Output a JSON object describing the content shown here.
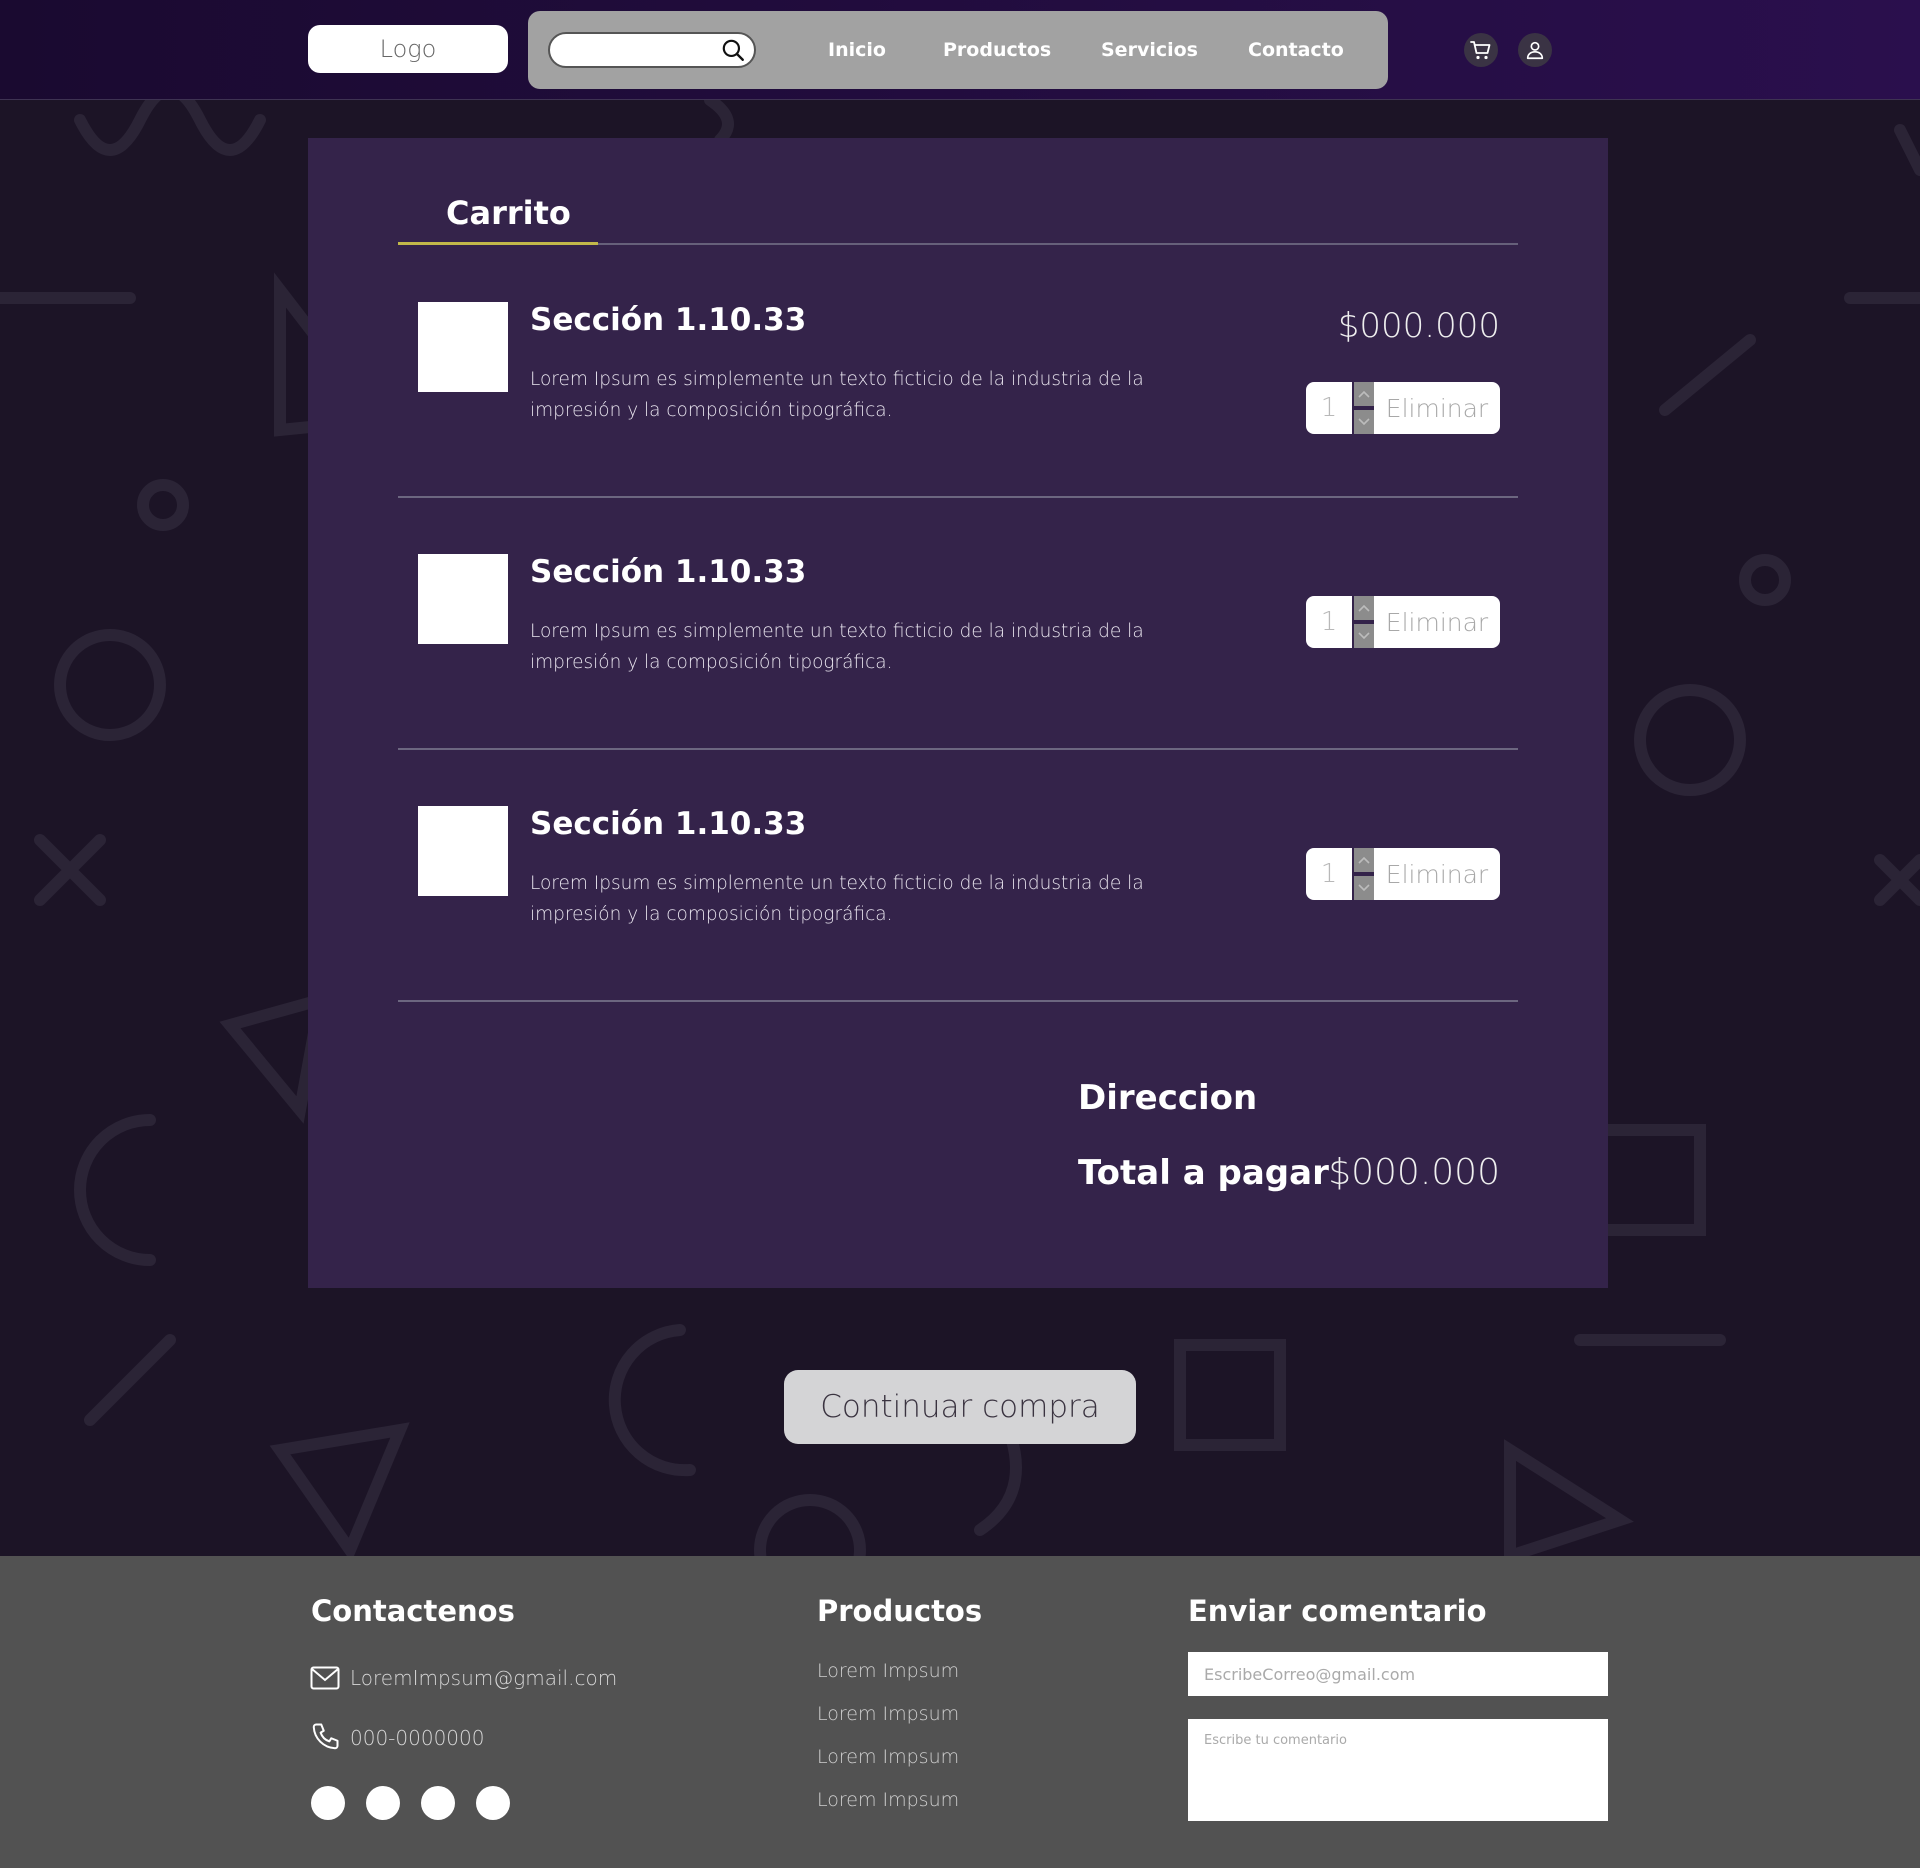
{
  "header": {
    "logo": "Logo",
    "search": {
      "value": "",
      "placeholder": ""
    },
    "nav": [
      "Inicio",
      "Productos",
      "Servicios",
      "Contacto"
    ],
    "icons": [
      "cart-icon",
      "user-icon"
    ]
  },
  "cart": {
    "title": "Carrito",
    "items": [
      {
        "name": "Sección 1.10.33",
        "description": "Lorem Ipsum es simplemente un texto ficticio de la industria de la impresión y la composición tipográfica.",
        "price": "$000.000",
        "quantity": "1",
        "remove_label": "Eliminar"
      },
      {
        "name": "Sección 1.10.33",
        "description": "Lorem Ipsum es simplemente un texto ficticio de la industria de la impresión y la composición tipográfica.",
        "price": "",
        "quantity": "1",
        "remove_label": "Eliminar"
      },
      {
        "name": "Sección 1.10.33",
        "description": "Lorem Ipsum es simplemente un texto ficticio de la industria de la impresión y la composición tipográfica.",
        "price": "",
        "quantity": "1",
        "remove_label": "Eliminar"
      }
    ],
    "summary": {
      "address_label": "Direccion",
      "total_label": "Total a pagar",
      "total_value": "$000.000"
    },
    "continue_label": "Continuar compra"
  },
  "footer": {
    "contact": {
      "heading": "Contactenos",
      "email": "LoremImpsum@gmail.com",
      "phone": "000-0000000"
    },
    "products": {
      "heading": "Productos",
      "links": [
        "Lorem Impsum",
        "Lorem Impsum",
        "Lorem Impsum",
        "Lorem Impsum"
      ]
    },
    "feedback": {
      "heading": "Enviar comentario",
      "email_placeholder": "EscribeCorreo@gmail.com",
      "comment_placeholder": "Escribe tu comentario"
    }
  },
  "colors": {
    "header_start": "#1a0a30",
    "header_end": "#2a0f4d",
    "page_bg": "#1c1426",
    "panel_bg": "#34234a",
    "tab_accent": "#c2b84a",
    "footer_bg": "#525252"
  }
}
